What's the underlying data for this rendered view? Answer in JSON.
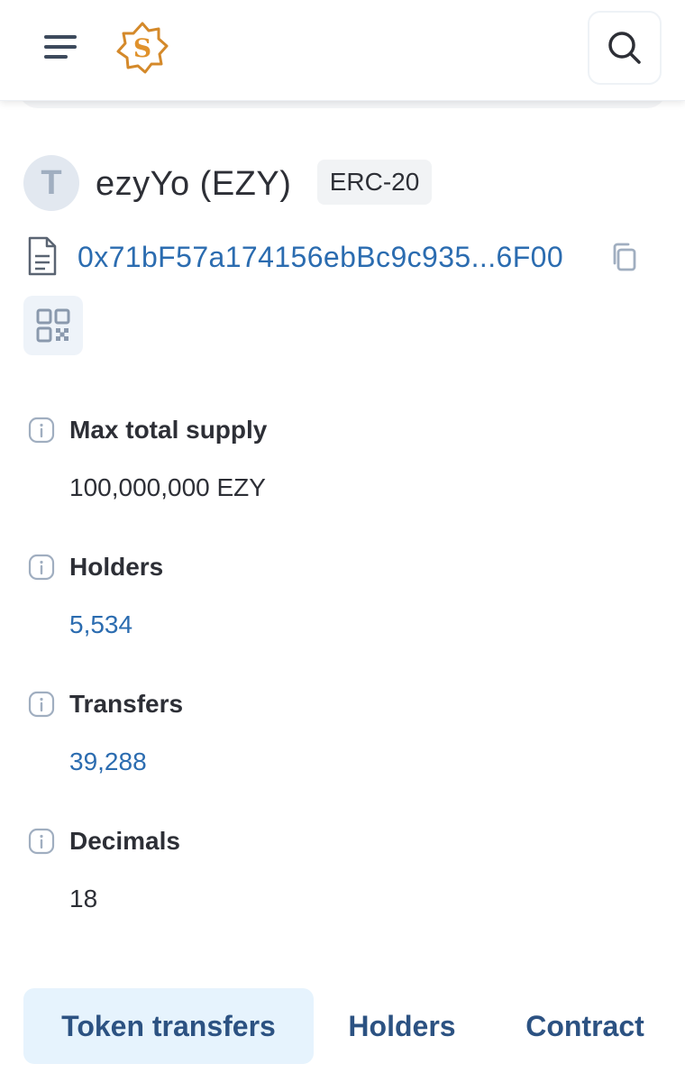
{
  "header": {
    "menu_icon": "hamburger-menu-icon",
    "logo_icon": "blockscout-logo-icon",
    "search_icon": "search-icon"
  },
  "token": {
    "avatar_letter": "T",
    "name": "ezyYo (EZY)",
    "type_badge": "ERC-20",
    "address": "0x71bF57a174156ebBc9c935...6F00"
  },
  "details": [
    {
      "label": "Max total supply",
      "value": "100,000,000 EZY",
      "link": false
    },
    {
      "label": "Holders",
      "value": "5,534",
      "link": true
    },
    {
      "label": "Transfers",
      "value": "39,288",
      "link": true
    },
    {
      "label": "Decimals",
      "value": "18",
      "link": false
    }
  ],
  "tabs": [
    {
      "label": "Token transfers",
      "active": true
    },
    {
      "label": "Holders",
      "active": false
    },
    {
      "label": "Contract",
      "active": false
    }
  ],
  "colors": {
    "link": "#2b6cb0",
    "tab_text": "#2c5282",
    "tab_active_bg": "#e6f3fd",
    "logo_gold": "#d4892a"
  }
}
